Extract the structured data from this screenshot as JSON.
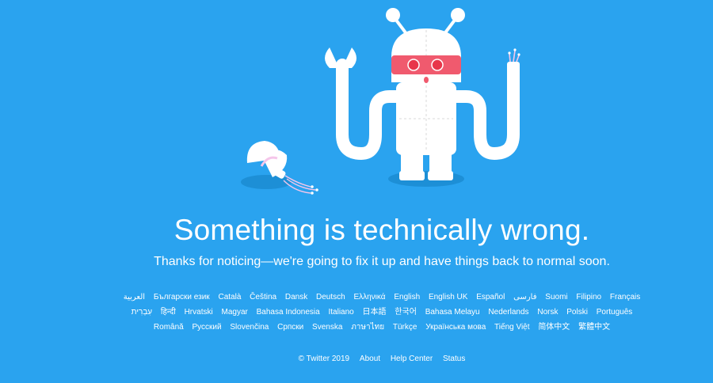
{
  "error": {
    "headline": "Something is technically wrong.",
    "message": "Thanks for noticing—we're going to fix it up and have things back to normal soon."
  },
  "languages": [
    "العربية",
    "Български език",
    "Català",
    "Čeština",
    "Dansk",
    "Deutsch",
    "Ελληνικά",
    "English",
    "English UK",
    "Español",
    "فارسی",
    "Suomi",
    "Filipino",
    "Français",
    "עִבְרִית",
    "हिन्दी",
    "Hrvatski",
    "Magyar",
    "Bahasa Indonesia",
    "Italiano",
    "日本語",
    "한국어",
    "Bahasa Melayu",
    "Nederlands",
    "Norsk",
    "Polski",
    "Português",
    "Română",
    "Русский",
    "Slovenčina",
    "Српски",
    "Svenska",
    "ภาษาไทย",
    "Türkçe",
    "Українська мова",
    "Tiếng Việt",
    "简体中文",
    "繁體中文"
  ],
  "footer": {
    "copyright": "© Twitter 2019",
    "about": "About",
    "help_center": "Help Center",
    "status": "Status"
  },
  "colors": {
    "background": "#2aa3ef",
    "robot_body": "#ffffff",
    "robot_visor": "#f05a6e",
    "robot_eyes": "#e8364a",
    "shadow": "#1d8fd6"
  },
  "icons": {
    "illustration": "broken-robot-illustration"
  }
}
